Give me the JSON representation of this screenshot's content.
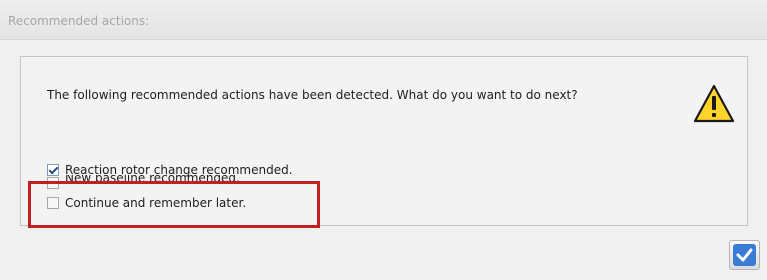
{
  "dialog": {
    "title": "Recommended actions:",
    "question": "The following recommended actions have been detected. What do you want to do next?",
    "icon": "warning-icon",
    "options": [
      {
        "label": "Reaction rotor change recommended.",
        "checked": true
      },
      {
        "label": "New baseline recommended.",
        "checked": false
      },
      {
        "label": "Continue and remember later.",
        "checked": false
      }
    ],
    "confirm_icon": "checkmark-icon"
  },
  "colors": {
    "highlight": "#c02020",
    "confirm": "#3a7bd5",
    "warning_fill": "#ffd42a"
  }
}
